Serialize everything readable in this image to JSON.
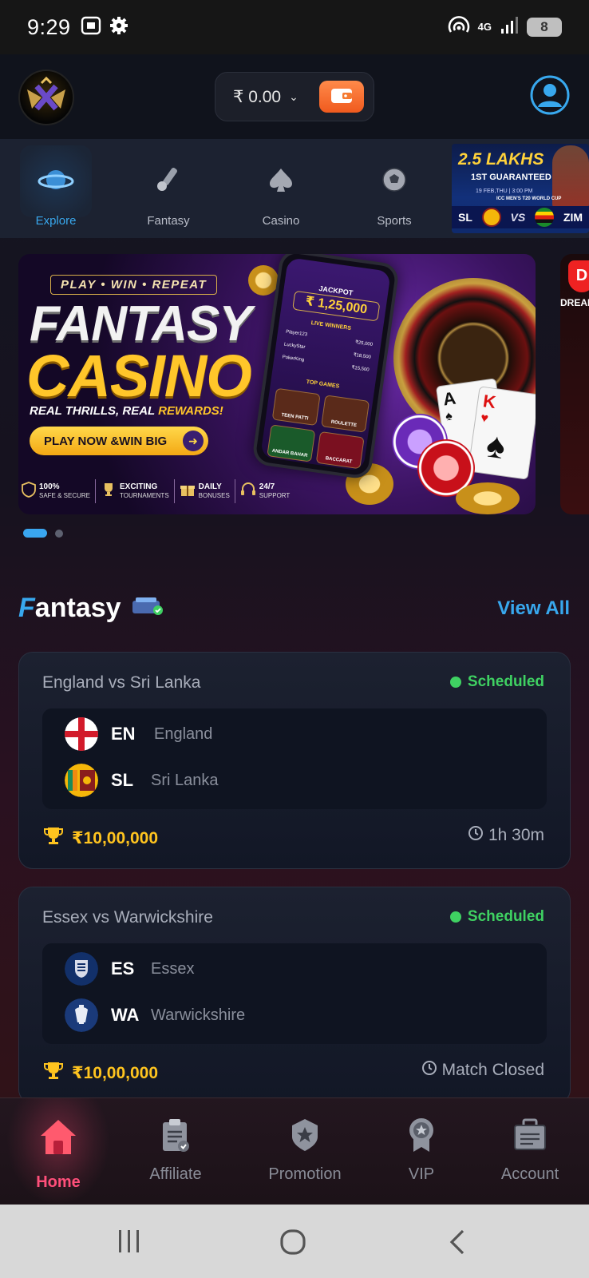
{
  "status_bar": {
    "time": "9:29",
    "battery": "8",
    "network": "4G"
  },
  "header": {
    "wallet_amount": "₹ 0.00"
  },
  "categories": [
    {
      "label": "Explore",
      "icon": "planet-icon",
      "active": true
    },
    {
      "label": "Fantasy",
      "icon": "cricket-bat-icon",
      "active": false
    },
    {
      "label": "Casino",
      "icon": "spade-icon",
      "active": false
    },
    {
      "label": "Sports",
      "icon": "football-icon",
      "active": false
    }
  ],
  "mini_promo": {
    "headline": "2.5 LAKHS",
    "sub": "1ST GUARANTEED",
    "date": "19 FEB,THU | 3:00 PM",
    "event": "ICC MEN'S T20 WORLD CUP",
    "team1": "SL",
    "vs": "VS",
    "team2": "ZIM"
  },
  "banner": {
    "tag": "PLAY • WIN • REPEAT",
    "title1": "FANTASY",
    "title2": "CASINO",
    "tagline_a": "REAL THRILLS, REAL ",
    "tagline_b": "REWARDS!",
    "cta": "PLAY NOW &WIN BIG",
    "features": [
      {
        "title": "100%",
        "sub": "SAFE & SECURE"
      },
      {
        "title": "EXCITING",
        "sub": "TOURNAMENTS"
      },
      {
        "title": "DAILY",
        "sub": "BONUSES"
      },
      {
        "title": "24/7",
        "sub": "SUPPORT"
      }
    ],
    "phone": {
      "jackpot_label": "JACKPOT",
      "jackpot_value": "₹ 1,25,000",
      "live_winners_label": "LIVE WINNERS",
      "winners": [
        {
          "name": "Player123",
          "amount": "₹25,000"
        },
        {
          "name": "LuckyStar",
          "amount": "₹18,500"
        },
        {
          "name": "PokerKing",
          "amount": "₹15,500"
        }
      ],
      "top_games_label": "TOP GAMES",
      "games": [
        "TEEN PATTI",
        "ROULETTE",
        "ANDAR BAHAR",
        "BACCARAT"
      ]
    },
    "cards": [
      "A",
      "K"
    ],
    "next_banner_text": "DREAM"
  },
  "fantasy_section": {
    "title_first": "F",
    "title_rest": "antasy",
    "view_all": "View All"
  },
  "matches": [
    {
      "title": "England vs Sri Lanka",
      "status": "Scheduled",
      "team1": {
        "code": "EN",
        "name": "England"
      },
      "team2": {
        "code": "SL",
        "name": "Sri Lanka"
      },
      "prize": "₹10,00,000",
      "time": "1h 30m"
    },
    {
      "title": "Essex vs Warwickshire",
      "status": "Scheduled",
      "team1": {
        "code": "ES",
        "name": "Essex"
      },
      "team2": {
        "code": "WA",
        "name": "Warwickshire"
      },
      "prize": "₹10,00,000",
      "time": "Match Closed"
    }
  ],
  "bottom_nav": [
    {
      "label": "Home",
      "icon": "home-icon",
      "active": true
    },
    {
      "label": "Affiliate",
      "icon": "clipboard-icon",
      "active": false
    },
    {
      "label": "Promotion",
      "icon": "badge-star-icon",
      "active": false
    },
    {
      "label": "VIP",
      "icon": "medal-icon",
      "active": false
    },
    {
      "label": "Account",
      "icon": "briefcase-icon",
      "active": false
    }
  ],
  "colors": {
    "accent_blue": "#38a8ee",
    "status_green": "#3fd162",
    "prize_gold": "#ffc41f",
    "home_pink": "#ff4f7a",
    "wallet_orange": "#f05a1e"
  }
}
